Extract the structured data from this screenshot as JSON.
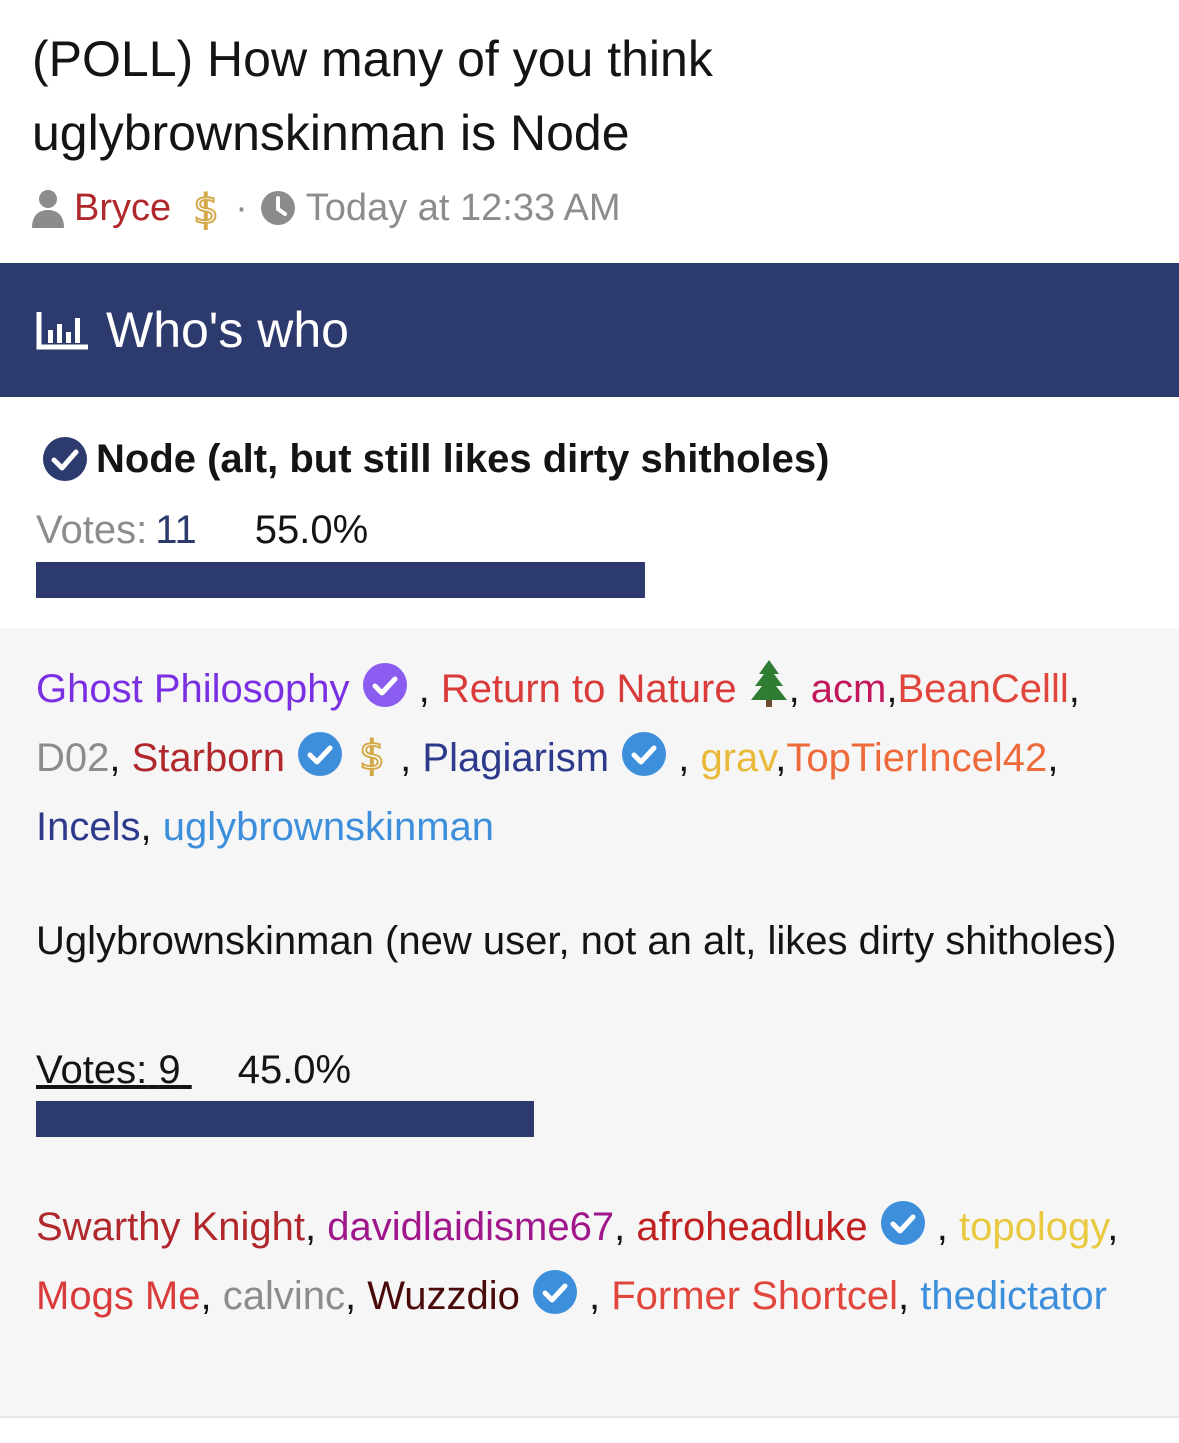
{
  "thread": {
    "title": "(POLL) How many of you think uglybrownskinman is Node",
    "author": "Bryce",
    "author_badge_icon": "dollar-icon",
    "separator": "·",
    "timestamp": "Today at 12:33 AM"
  },
  "poll": {
    "header_title": "Who's who",
    "header_icon": "bar-chart-icon",
    "accent_color": "#2d3a6e",
    "options": [
      {
        "label": "Node (alt, but still likes dirty shitholes)",
        "selected": true,
        "votes_label": "Votes:",
        "votes": "11",
        "percent_text": "55.0%",
        "percent": 55.0,
        "voters": [
          {
            "name": "Ghost Philosophy",
            "color": "#7b2fe3",
            "badge": "verified-purple-icon",
            "sep": " , "
          },
          {
            "name": "Return to Nature",
            "color": "#d93a3a",
            "badge": "tree-icon",
            "sep": ", "
          },
          {
            "name": "acm",
            "color": "#c2185b",
            "sep": ","
          },
          {
            "name": "BeanCelll",
            "color": "#e0463c",
            "sep": ", "
          },
          {
            "name": "D02",
            "color": "#8c8c8c",
            "sep": ", "
          },
          {
            "name": "Starborn",
            "color": "#b0282c",
            "badge": "verified-blue-icon",
            "badge2": "dollar-icon",
            "sep": " , "
          },
          {
            "name": "Plagiarism",
            "color": "#2d3a8c",
            "badge": "verified-blue-icon",
            "sep": " , "
          },
          {
            "name": "grav",
            "color": "#e9b93a",
            "sep": ","
          },
          {
            "name": "TopTierIncel42",
            "color": "#ee6a3a",
            "sep": ", "
          },
          {
            "name": "Incels",
            "color": "#2d3a8c",
            "sep": ", "
          },
          {
            "name": "uglybrownskinman",
            "color": "#3d8fdc",
            "sep": ""
          }
        ]
      },
      {
        "label": "Uglybrownskinman (new user, not an alt, likes dirty shitholes)",
        "selected": false,
        "votes_label": "Votes:",
        "votes": "9",
        "percent_text": "45.0%",
        "percent": 45.0,
        "voters": [
          {
            "name": "Swarthy Knight",
            "color": "#b0282c",
            "sep": ", "
          },
          {
            "name": "davidlaidisme67",
            "color": "#a0178c",
            "sep": ", "
          },
          {
            "name": "afroheadluke",
            "color": "#c0201f",
            "badge": "verified-blue-icon",
            "sep": " , "
          },
          {
            "name": "topology",
            "color": "#e9c940",
            "sep": ", "
          },
          {
            "name": "Mogs Me",
            "color": "#d93a3a",
            "sep": ", "
          },
          {
            "name": "calvinc",
            "color": "#8c8c8c",
            "sep": ", "
          },
          {
            "name": "Wuzzdio",
            "color": "#4a0a0a",
            "badge": "verified-blue-icon",
            "sep": " , "
          },
          {
            "name": "Former Shortcel",
            "color": "#e0463c",
            "sep": ", "
          },
          {
            "name": "thedictator",
            "color": "#3d8fdc",
            "sep": ""
          }
        ]
      }
    ]
  }
}
